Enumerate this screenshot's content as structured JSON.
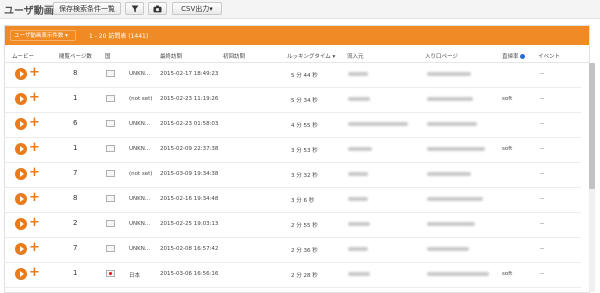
{
  "toolbar": {
    "title": "ユーザ動画",
    "saved_search_label": "保存検索条件一覧",
    "filter_icon": "filter-icon",
    "camera_icon": "camera-icon",
    "csv_label": "CSV出力▾"
  },
  "panel": {
    "selector_label": "ユーザ動画表示件数 ▾",
    "range_label": "1 - 20 訪問表 (1441)"
  },
  "columns": {
    "movie": "ムービー",
    "pageviews": "閲覧ページ数",
    "country": "国",
    "last_visit": "最終訪問",
    "first_visit": "初回訪問",
    "looking_time": "ルッキングタイム ▾",
    "referrer": "流入元",
    "landing_page": "入り口ページ",
    "bounce_rate": "直帰率",
    "event": "イベント"
  },
  "rows": [
    {
      "pv": "8",
      "region": "UNKN...",
      "last_visit": "2015-02-17 18:49:23",
      "looking_time": "5 分 44 秒",
      "bounce": "",
      "event": "--"
    },
    {
      "pv": "1",
      "region": "(not set)",
      "last_visit": "2015-02-23 11:19:26",
      "looking_time": "5 分 34 秒",
      "bounce": "soft",
      "event": "--"
    },
    {
      "pv": "6",
      "region": "UNKN...",
      "last_visit": "2015-02-23 01:58:03",
      "looking_time": "4 分 55 秒",
      "bounce": "",
      "event": "--"
    },
    {
      "pv": "1",
      "region": "UNKN...",
      "last_visit": "2015-02-09 22:37:38",
      "looking_time": "3 分 53 秒",
      "bounce": "soft",
      "event": "--"
    },
    {
      "pv": "7",
      "region": "(not set)",
      "last_visit": "2015-03-09 19:34:38",
      "looking_time": "3 分 32 秒",
      "bounce": "",
      "event": "--"
    },
    {
      "pv": "8",
      "region": "UNKN...",
      "last_visit": "2015-02-16 19:34:48",
      "looking_time": "3 分 6 秒",
      "bounce": "",
      "event": "--"
    },
    {
      "pv": "2",
      "region": "UNKN...",
      "last_visit": "2015-02-25 19:03:13",
      "looking_time": "2 分 55 秒",
      "bounce": "",
      "event": "--"
    },
    {
      "pv": "7",
      "region": "UNKN...",
      "last_visit": "2015-02-08 16:57:42",
      "looking_time": "2 分 36 秒",
      "bounce": "",
      "event": "--"
    },
    {
      "pv": "1",
      "region": "日本",
      "last_visit": "2015-03-06 16:56:16",
      "looking_time": "2 分 28 秒",
      "bounce": "soft",
      "event": "--"
    }
  ],
  "colors": {
    "accent": "#f08a24",
    "play": "#ec7a17"
  }
}
